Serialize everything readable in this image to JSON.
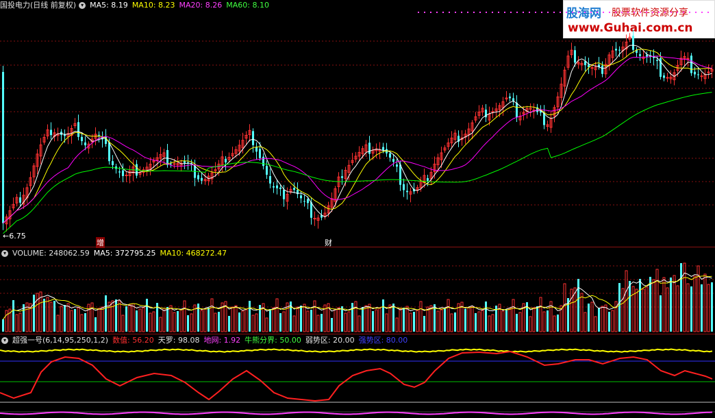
{
  "main": {
    "title": "国投电力(日线 前复权)",
    "ma5": "MA5: 8.19",
    "ma10": "MA10: 8.23",
    "ma20": "MA20: 8.26",
    "ma60": "MA60: 8.10",
    "low_label": "6.75",
    "marker1": "增",
    "marker2": "财"
  },
  "volume": {
    "label": "VOLUME: 248062.59",
    "ma5": "MA5: 372795.25",
    "ma10": "MA10: 468272.47"
  },
  "indicator": {
    "name": "超强一号(6,14,95,250,1,2)",
    "v1": "数值: 56.20",
    "v2": "天罗: 98.08",
    "v3": "地网: 1.92",
    "v4": "牛熊分界: 50.00",
    "v5": "弱势区: 20.00",
    "v6": "强势区: 80.00"
  },
  "watermark": {
    "brand": "股海网",
    "slogan": "股票软件资源分享",
    "url": "www.Guhai.com.cn"
  },
  "colors": {
    "up": "#ff3232",
    "down": "#54ffff",
    "ma5": "#ffffff",
    "ma10": "#ffff00",
    "ma20": "#ff00ff",
    "ma60": "#00ff00",
    "grid": "#8a1010"
  }
}
